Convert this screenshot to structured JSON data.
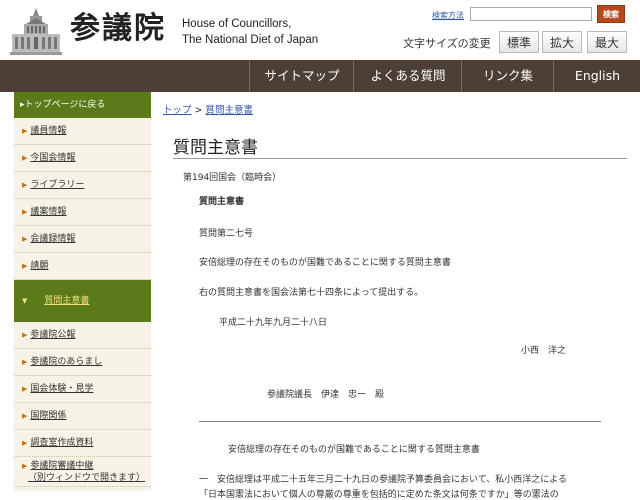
{
  "header": {
    "logo_kanji": "参議院",
    "logo_en_line1": "House of Councillors,",
    "logo_en_line2": "The National Diet of Japan",
    "search_link": "検索方法",
    "search_placeholder": "",
    "search_button": "検索",
    "fontsize_label": "文字サイズの変更",
    "fontsize_std": "標準",
    "fontsize_large": "拡大",
    "fontsize_max": "最大"
  },
  "nav": {
    "sitemap": "サイトマップ",
    "faq": "よくある質問",
    "links": "リンク集",
    "english": "English"
  },
  "sidebar": {
    "top": "▸トップページに戻る",
    "items": [
      "議員情報",
      "今国会情報",
      "ライブラリー",
      "議案情報",
      "会議録情報",
      "請願",
      "質問主意書",
      "参議院公報",
      "参議院のあらまし",
      "国会体験・見学",
      "国際関係",
      "調査室作成資料",
      "参議院審議中継",
      "（別ウィンドウで開きます）"
    ],
    "active_index": 6
  },
  "breadcrumb": {
    "home": "トップ",
    "sep": ">",
    "current": "質問主意書"
  },
  "main": {
    "title": "質問主意書",
    "session": "第194回国会（臨時会）",
    "doc_heading": "質問主意書",
    "number": "質問第二七号",
    "subject": "安倍総理の存在そのものが国難であることに関する質問主意書",
    "submit_text": "右の質問主意書を国会法第七十四条によって提出する。",
    "date": "平成二十九年九月二十八日",
    "author": "小西　洋之",
    "addressee": "参議院議長　伊達　忠一　殿",
    "subject2": "安倍総理の存在そのものが国難であることに関する質問主意書",
    "body_line1": "一　安倍総理は平成二十五年三月二十九日の参議院予算委員会において、私小西洋之による",
    "body_line2": "「日本国憲法において個人の尊厳の尊重を包括的に定めた条文は何条ですか」等の憲法の"
  }
}
